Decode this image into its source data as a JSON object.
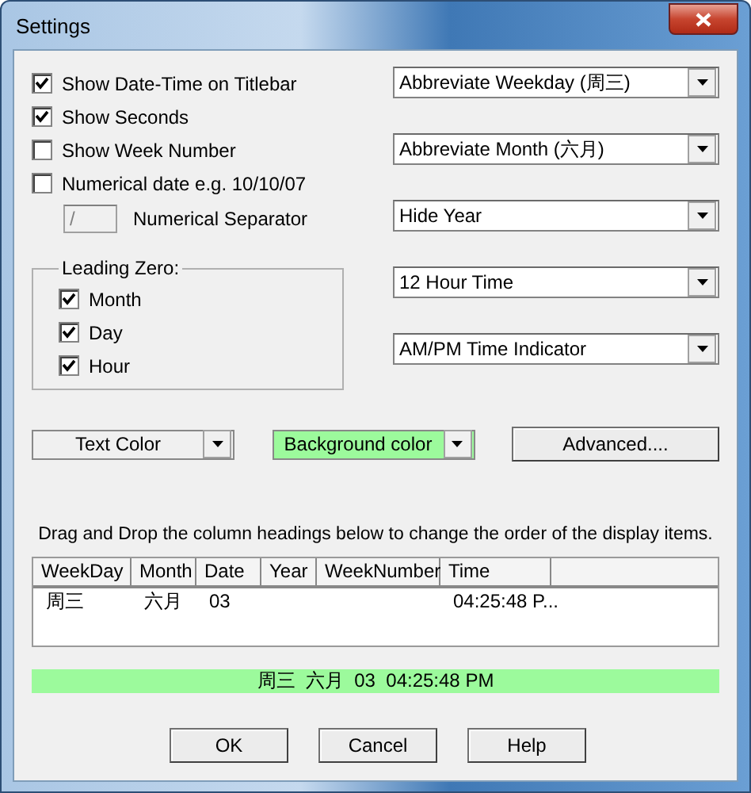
{
  "window": {
    "title": "Settings"
  },
  "options": [
    {
      "label": "Show Date-Time on Titlebar",
      "checked": true
    },
    {
      "label": "Show Seconds",
      "checked": true
    },
    {
      "label": "Show Week Number",
      "checked": false
    },
    {
      "label": "Numerical date e.g. 10/10/07",
      "checked": false
    }
  ],
  "separator": {
    "value": "/",
    "label": "Numerical Separator"
  },
  "leading_zero": {
    "title": "Leading Zero:",
    "options": [
      {
        "label": "Month",
        "checked": true
      },
      {
        "label": "Day",
        "checked": true
      },
      {
        "label": "Hour",
        "checked": true
      }
    ]
  },
  "dropdowns": [
    "Abbreviate Weekday (周三)",
    "Abbreviate Month (六月)",
    "Hide Year",
    "12 Hour Time",
    "AM/PM Time Indicator"
  ],
  "color_pickers": [
    {
      "label": "Text Color"
    },
    {
      "label": "Background color",
      "color": "#9cfa9c"
    }
  ],
  "advanced_button": "Advanced....",
  "instruction": "Drag and Drop the column headings below to change the order of the display items.",
  "table": {
    "columns": [
      "WeekDay",
      "Month",
      "Date",
      "Year",
      "WeekNumber",
      "Time"
    ],
    "rows": [
      [
        "周三",
        "六月",
        "03",
        "",
        "",
        "04:25:48 P..."
      ]
    ]
  },
  "preview": {
    "text": "周三  六月  03  04:25:48 PM",
    "color": "#9cfa9c"
  },
  "buttons": [
    "OK",
    "Cancel",
    "Help"
  ]
}
